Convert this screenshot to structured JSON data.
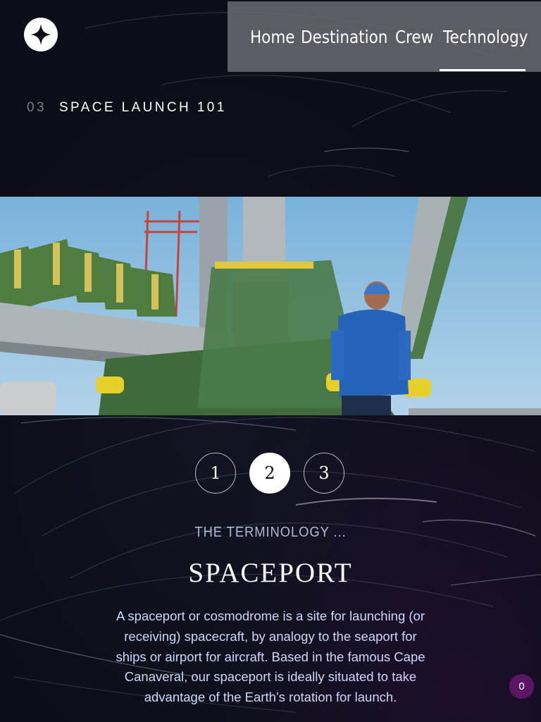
{
  "logo": {
    "icon": "star-logo-icon"
  },
  "nav": {
    "items": [
      {
        "label": "Home"
      },
      {
        "label": "Destination"
      },
      {
        "label": "Crew"
      },
      {
        "label": "Technology",
        "active": true
      }
    ]
  },
  "heading": {
    "number": "03",
    "text": "SPACE LAUNCH 101"
  },
  "hero": {
    "icon": "launch-pad-image"
  },
  "pager": {
    "pages": [
      "1",
      "2",
      "3"
    ],
    "active": "2"
  },
  "content": {
    "eyebrow": "THE TERMINOLOGY ...",
    "title": "SPACEPORT",
    "description": "A spaceport or cosmodrome is a site for launching (or receiving) spacecraft, by analogy to the seaport for ships or airport for aircraft. Based in the famous Cape Canaveral, our spaceport is ideally situated to take advantage of the Earth’s rotation for launch."
  },
  "badge": {
    "count": "0"
  },
  "colors": {
    "background": "#0b0d17",
    "nav_bg": "#6e6e76",
    "text_muted": "#d0d6f9",
    "badge": "#5a1664"
  }
}
